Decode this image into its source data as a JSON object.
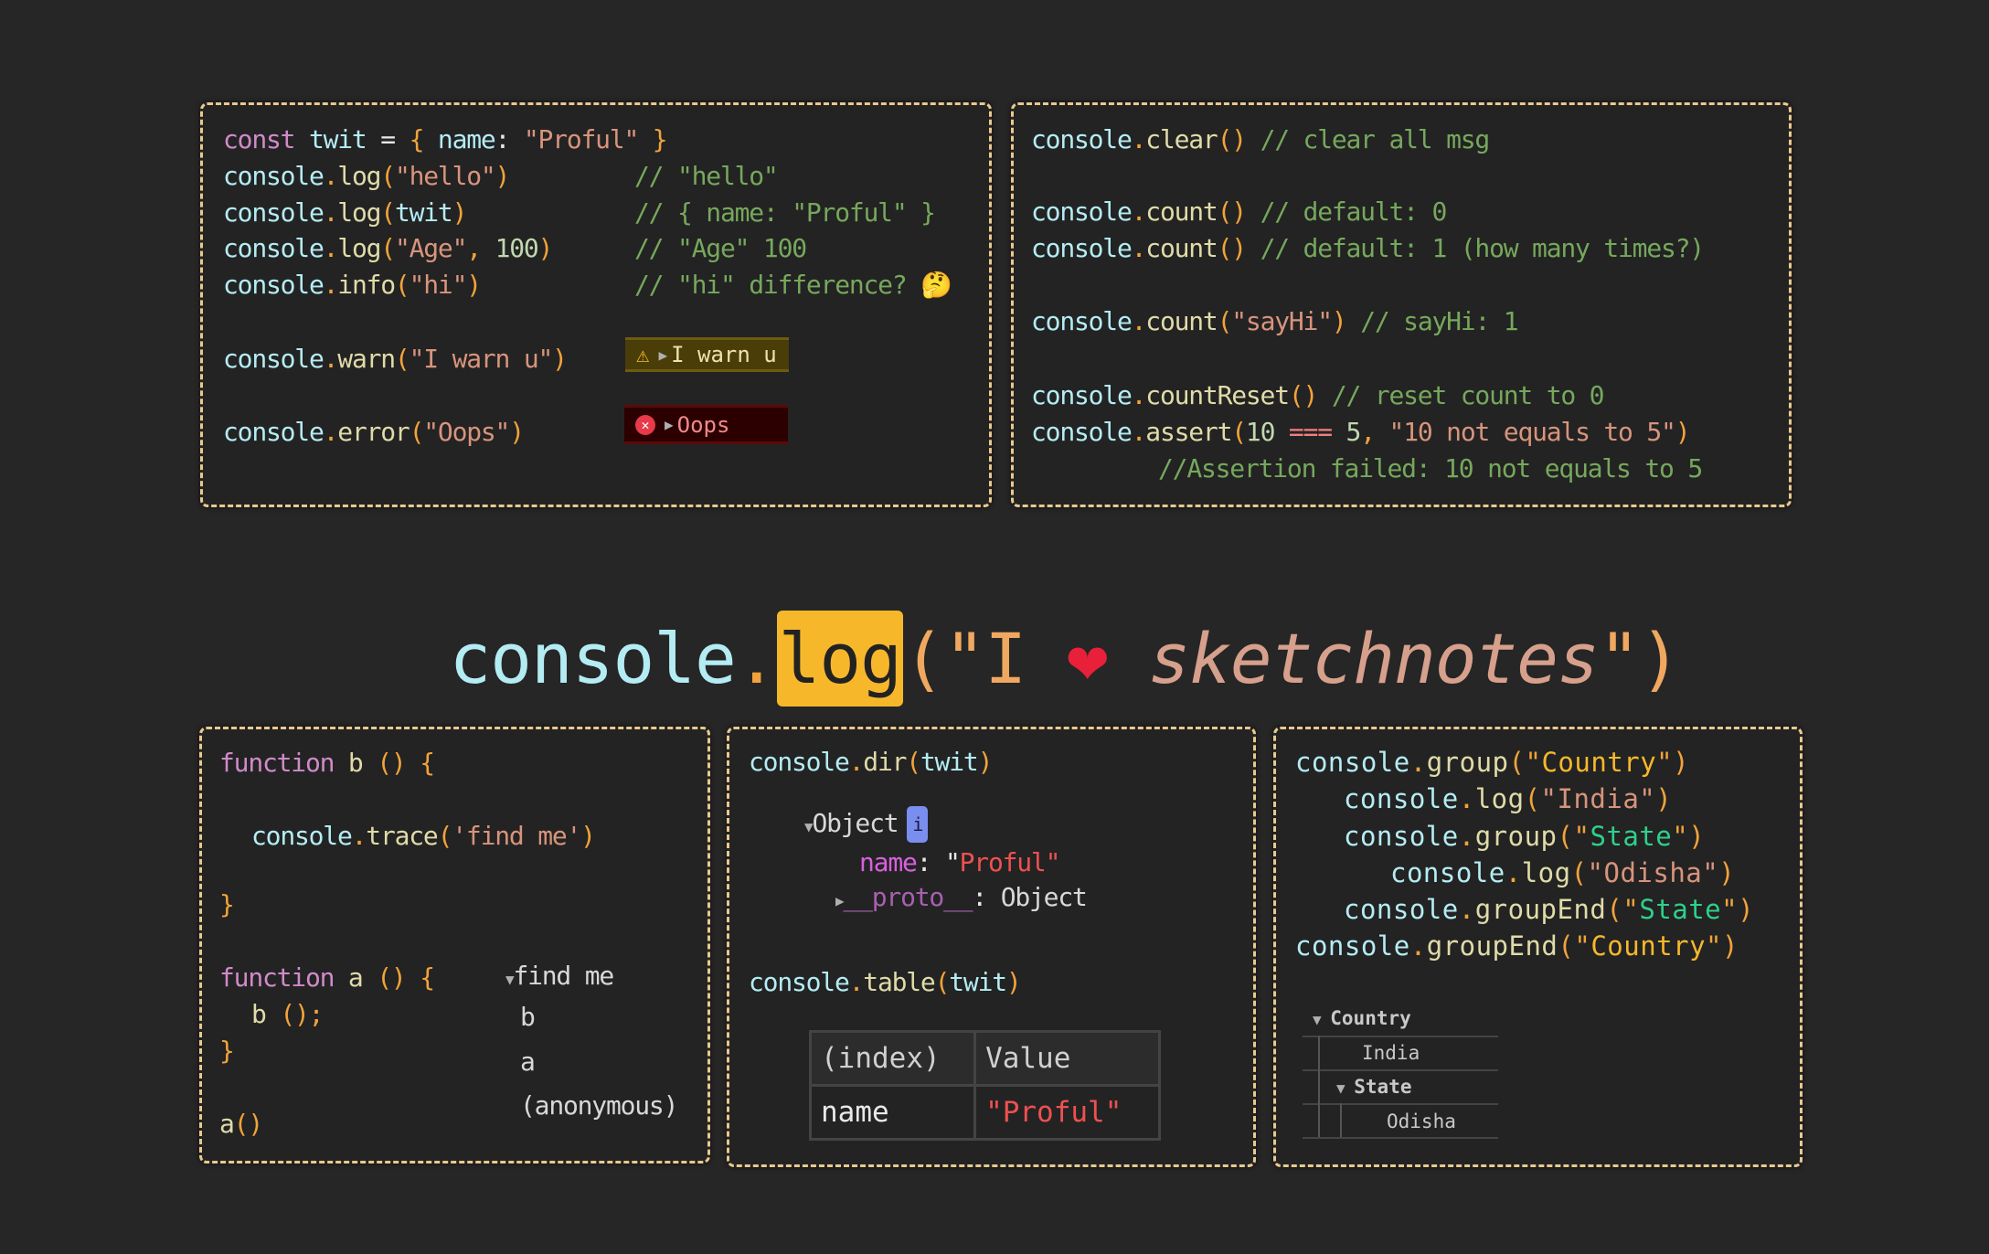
{
  "colors": {
    "background": "#262626",
    "border": "#e9c98e",
    "highlight": "#f6b82a",
    "heart": "#e8203a"
  },
  "box1": {
    "lines": [
      [
        [
          "const ",
          "k"
        ],
        [
          "twit ",
          "c"
        ],
        [
          "= ",
          "w"
        ],
        [
          "{ ",
          "p"
        ],
        [
          "name",
          "c"
        ],
        [
          ": ",
          "w"
        ],
        [
          "\"Proful\" ",
          "s"
        ],
        [
          "}",
          "p"
        ]
      ],
      [
        [
          "console",
          "c"
        ],
        [
          ".",
          "p"
        ],
        [
          "log",
          "m"
        ],
        [
          "(",
          "p"
        ],
        [
          "\"hello\"",
          "s"
        ],
        [
          ")",
          "p"
        ]
      ],
      [
        [
          "console",
          "c"
        ],
        [
          ".",
          "p"
        ],
        [
          "log",
          "m"
        ],
        [
          "(",
          "p"
        ],
        [
          "twit",
          "c"
        ],
        [
          ")",
          "p"
        ]
      ],
      [
        [
          "console",
          "c"
        ],
        [
          ".",
          "p"
        ],
        [
          "log",
          "m"
        ],
        [
          "(",
          "p"
        ],
        [
          "\"Age\"",
          "s"
        ],
        [
          ", ",
          "p"
        ],
        [
          "100",
          "n"
        ],
        [
          ")",
          "p"
        ]
      ],
      [
        [
          "console",
          "c"
        ],
        [
          ".",
          "p"
        ],
        [
          "info",
          "m"
        ],
        [
          "(",
          "p"
        ],
        [
          "\"hi\"",
          "s"
        ],
        [
          ")",
          "p"
        ]
      ],
      [
        [
          "console",
          "c"
        ],
        [
          ".",
          "p"
        ],
        [
          "warn",
          "m"
        ],
        [
          "(",
          "p"
        ],
        [
          "\"I warn u\"",
          "s"
        ],
        [
          ")",
          "p"
        ]
      ],
      [
        [
          "console",
          "c"
        ],
        [
          ".",
          "p"
        ],
        [
          "error",
          "m"
        ],
        [
          "(",
          "p"
        ],
        [
          "\"Oops\"",
          "s"
        ],
        [
          ")",
          "p"
        ]
      ]
    ],
    "comments": [
      "// \"hello\"",
      "// { name: \"Proful\" }",
      "// \"Age\" 100",
      "// \"hi\" difference? 🤔"
    ],
    "warn_badge": {
      "icon": "warning-icon",
      "text": "I warn u"
    },
    "error_badge": {
      "icon": "error-icon",
      "text": "Oops"
    }
  },
  "box2": {
    "lines": [
      [
        [
          "console",
          "c"
        ],
        [
          ".",
          "p"
        ],
        [
          "clear",
          "m"
        ],
        [
          "()",
          "p"
        ],
        [
          " // clear all msg",
          "cm"
        ]
      ],
      [
        [
          "console",
          "c"
        ],
        [
          ".",
          "p"
        ],
        [
          "count",
          "m"
        ],
        [
          "()",
          "p"
        ],
        [
          " // default: 0",
          "cm"
        ]
      ],
      [
        [
          "console",
          "c"
        ],
        [
          ".",
          "p"
        ],
        [
          "count",
          "m"
        ],
        [
          "()",
          "p"
        ],
        [
          " // default: 1 (how many times?)",
          "cm"
        ]
      ],
      [
        [
          "console",
          "c"
        ],
        [
          ".",
          "p"
        ],
        [
          "count",
          "m"
        ],
        [
          "(",
          "p"
        ],
        [
          "\"sayHi\"",
          "s"
        ],
        [
          ")",
          "p"
        ],
        [
          " // sayHi: 1",
          "cm"
        ]
      ],
      [
        [
          "console",
          "c"
        ],
        [
          ".",
          "p"
        ],
        [
          "countReset",
          "m"
        ],
        [
          "()",
          "p"
        ],
        [
          " // reset count to 0",
          "cm"
        ]
      ],
      [
        [
          "console",
          "c"
        ],
        [
          ".",
          "p"
        ],
        [
          "assert",
          "m"
        ],
        [
          "(",
          "p"
        ],
        [
          "10 ",
          "n"
        ],
        [
          "=== ",
          "op"
        ],
        [
          "5",
          "n"
        ],
        [
          ", ",
          "p"
        ],
        [
          "\"10 not equals to 5\"",
          "s"
        ],
        [
          ")",
          "p"
        ]
      ],
      [
        [
          "//Assertion failed: 10 not equals to 5",
          "cm"
        ]
      ]
    ]
  },
  "title": {
    "obj": "console",
    "dot": ".",
    "method": "log",
    "open": "(\"I ",
    "heart": "❤",
    "word": "sketchnotes",
    "close": "\")"
  },
  "box3": {
    "lines": [
      [
        [
          "function ",
          "k"
        ],
        [
          "b ",
          "m"
        ],
        [
          "() ",
          "p"
        ],
        [
          "{",
          "p"
        ]
      ],
      [
        [
          "console",
          "c"
        ],
        [
          ".",
          "p"
        ],
        [
          "trace",
          "m"
        ],
        [
          "(",
          "p"
        ],
        [
          "'find me'",
          "s"
        ],
        [
          ")",
          "p"
        ]
      ],
      [
        [
          "}",
          "p"
        ]
      ],
      [
        [
          "function ",
          "k"
        ],
        [
          "a ",
          "m"
        ],
        [
          "() ",
          "p"
        ],
        [
          "{",
          "p"
        ]
      ],
      [
        [
          "b ",
          "m"
        ],
        [
          "()",
          "p"
        ],
        [
          ";",
          "p"
        ]
      ],
      [
        [
          "}",
          "p"
        ]
      ],
      [
        [
          "a",
          "m"
        ],
        [
          "()",
          "p"
        ]
      ]
    ],
    "trace_output": {
      "label": "find me",
      "frames": [
        "b",
        "a",
        "(anonymous)"
      ]
    }
  },
  "box4": {
    "lines": [
      [
        [
          "console",
          "c"
        ],
        [
          ".",
          "p"
        ],
        [
          "dir",
          "m"
        ],
        [
          "(",
          "p"
        ],
        [
          "twit",
          "c"
        ],
        [
          ")",
          "p"
        ]
      ],
      [
        [
          "console",
          "c"
        ],
        [
          ".",
          "p"
        ],
        [
          "table",
          "m"
        ],
        [
          "(",
          "p"
        ],
        [
          "twit",
          "c"
        ],
        [
          ")",
          "p"
        ]
      ]
    ],
    "dir_output": {
      "type": "Object",
      "info": "i",
      "key": "name",
      "value": "\"Proful\"",
      "proto_key": "__proto__",
      "proto_value": "Object"
    },
    "table": {
      "headers": [
        "(index)",
        "Value"
      ],
      "rows": [
        [
          "name",
          "\"Proful\""
        ]
      ]
    }
  },
  "box5": {
    "lines": [
      [
        [
          "console",
          "c"
        ],
        [
          ".",
          "p"
        ],
        [
          "group",
          "m"
        ],
        [
          "(",
          "p"
        ],
        [
          "\"",
          "p"
        ],
        [
          "Country",
          "y"
        ],
        [
          "\"",
          "p"
        ],
        [
          ")",
          "p"
        ]
      ],
      [
        [
          "console",
          "c"
        ],
        [
          ".",
          "p"
        ],
        [
          "log",
          "m"
        ],
        [
          "(",
          "p"
        ],
        [
          "\"India\"",
          "s"
        ],
        [
          ")",
          "p"
        ]
      ],
      [
        [
          "console",
          "c"
        ],
        [
          ".",
          "p"
        ],
        [
          "group",
          "m"
        ],
        [
          "(",
          "p"
        ],
        [
          "\"",
          "p"
        ],
        [
          "State",
          "g"
        ],
        [
          "\"",
          "p"
        ],
        [
          ")",
          "p"
        ]
      ],
      [
        [
          "console",
          "c"
        ],
        [
          ".",
          "p"
        ],
        [
          "log",
          "m"
        ],
        [
          "(",
          "p"
        ],
        [
          "\"Odisha\"",
          "s"
        ],
        [
          ")",
          "p"
        ]
      ],
      [
        [
          "console",
          "c"
        ],
        [
          ".",
          "p"
        ],
        [
          "groupEnd",
          "m"
        ],
        [
          "(",
          "p"
        ],
        [
          "\"",
          "p"
        ],
        [
          "State",
          "g"
        ],
        [
          "\"",
          "p"
        ],
        [
          ")",
          "p"
        ]
      ],
      [
        [
          "console",
          "c"
        ],
        [
          ".",
          "p"
        ],
        [
          "groupEnd",
          "m"
        ],
        [
          "(",
          "p"
        ],
        [
          "\"",
          "p"
        ],
        [
          "Country",
          "y"
        ],
        [
          "\"",
          "p"
        ],
        [
          ")",
          "p"
        ]
      ]
    ],
    "group_output": {
      "group": "Country",
      "item": "India",
      "subgroup": "State",
      "subitem": "Odisha"
    }
  }
}
